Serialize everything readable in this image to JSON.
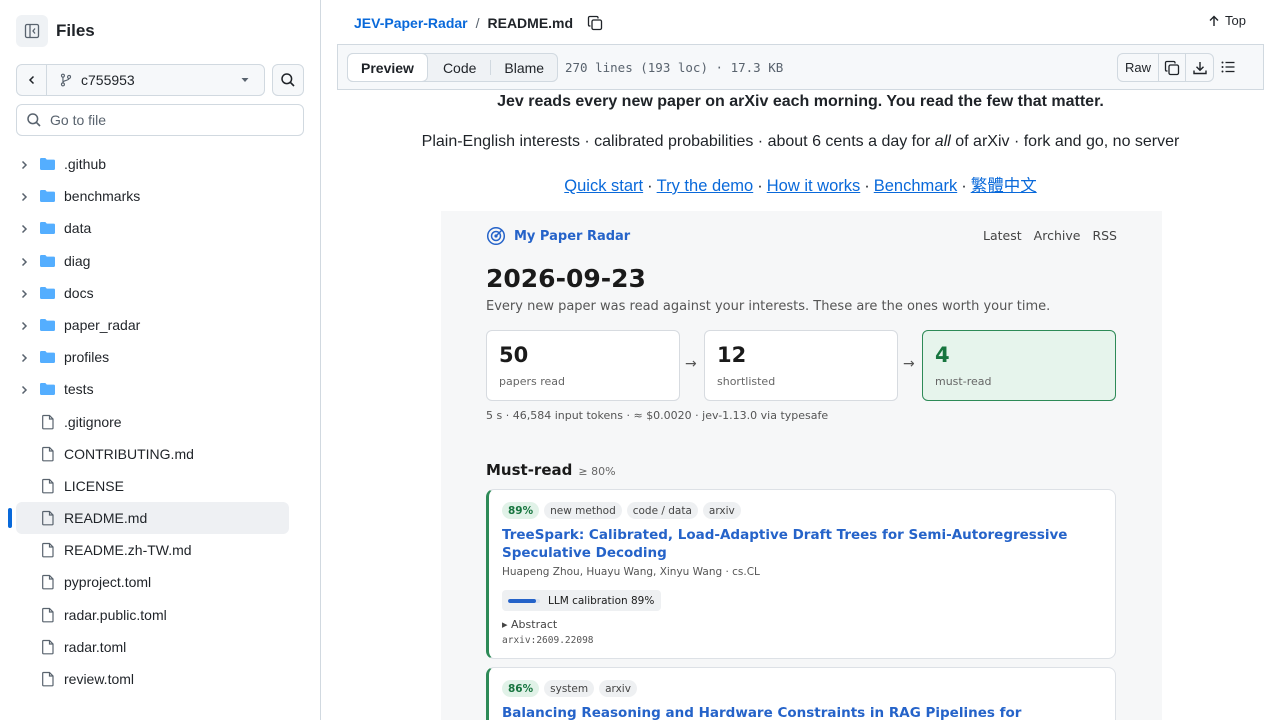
{
  "sidebar": {
    "title": "Files",
    "branch": "c755953",
    "goto_placeholder": "Go to file",
    "items": [
      {
        "name": ".github",
        "type": "dir"
      },
      {
        "name": "benchmarks",
        "type": "dir"
      },
      {
        "name": "data",
        "type": "dir"
      },
      {
        "name": "diag",
        "type": "dir"
      },
      {
        "name": "docs",
        "type": "dir"
      },
      {
        "name": "paper_radar",
        "type": "dir"
      },
      {
        "name": "profiles",
        "type": "dir"
      },
      {
        "name": "tests",
        "type": "dir"
      },
      {
        "name": ".gitignore",
        "type": "file"
      },
      {
        "name": "CONTRIBUTING.md",
        "type": "file"
      },
      {
        "name": "LICENSE",
        "type": "file"
      },
      {
        "name": "README.md",
        "type": "file",
        "selected": true
      },
      {
        "name": "README.zh-TW.md",
        "type": "file"
      },
      {
        "name": "pyproject.toml",
        "type": "file"
      },
      {
        "name": "radar.public.toml",
        "type": "file"
      },
      {
        "name": "radar.toml",
        "type": "file"
      },
      {
        "name": "review.toml",
        "type": "file"
      }
    ]
  },
  "header": {
    "repo": "JEV-Paper-Radar",
    "separator": "/",
    "file": "README.md",
    "top_label": "Top"
  },
  "fileheader": {
    "tabs": [
      "Preview",
      "Code",
      "Blame"
    ],
    "active_tab": "Preview",
    "info": "270 lines (193 loc) · 17.3 KB",
    "raw_label": "Raw"
  },
  "readme": {
    "tagline": "Jev reads every new paper on arXiv each morning. You read the few that matter.",
    "sub_before": "Plain-English interests · calibrated probabilities · about 6 cents a day for ",
    "sub_em": "all",
    "sub_after": " of arXiv · fork and go, no server",
    "links": [
      "Quick start",
      "Try the demo",
      "How it works",
      "Benchmark",
      "繁體中文"
    ],
    "link_separator": "·"
  },
  "demo": {
    "brand": "My Paper Radar",
    "nav": [
      "Latest",
      "Archive",
      "RSS"
    ],
    "date": "2026-09-23",
    "desc": "Every new paper was read against your interests. These are the ones worth your time.",
    "stats": [
      {
        "value": "50",
        "label": "papers read"
      },
      {
        "value": "12",
        "label": "shortlisted"
      },
      {
        "value": "4",
        "label": "must-read"
      }
    ],
    "arrow": "→",
    "meta": "5 s · 46,584 input tokens · ≈ $0.0020 · jev-1.13.0 via typesafe",
    "mustread_title": "Must-read",
    "mustread_threshold": "≥ 80%",
    "papers": [
      {
        "pct": "89%",
        "tags": [
          "new method",
          "code / data",
          "arxiv"
        ],
        "title": "TreeSpark: Calibrated, Load-Adaptive Draft Trees for Semi-Autoregressive Speculative Decoding",
        "authors": "Huapeng Zhou, Huayu Wang, Xinyu Wang · cs.CL",
        "calibration_label": "LLM calibration 89%",
        "calibration": 0.89,
        "abstract_label": "▸ Abstract",
        "id": "arxiv:2609.22098"
      },
      {
        "pct": "86%",
        "tags": [
          "system",
          "arxiv"
        ],
        "title": "Balancing Reasoning and Hardware Constraints in RAG Pipelines for Ukrainian"
      }
    ]
  },
  "colors": {
    "link": "#0969da",
    "demo_accent": "#2563c9",
    "mustread_green": "#2d8a57"
  }
}
